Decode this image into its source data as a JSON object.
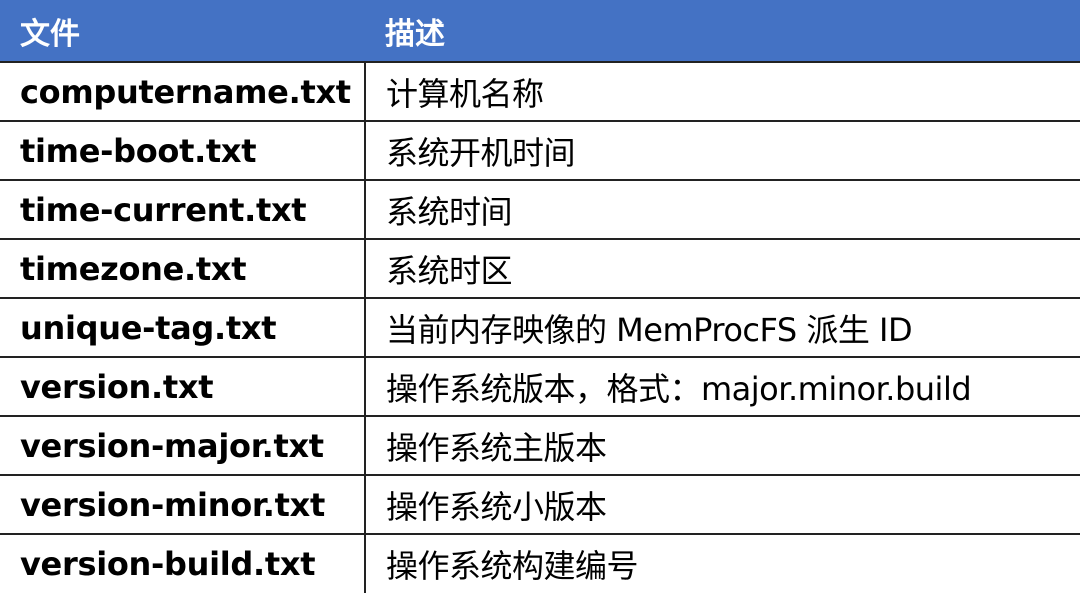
{
  "table": {
    "header": {
      "file": "文件",
      "description": "描述"
    },
    "colors": {
      "header_background": "#4472c4",
      "header_text": "#ffffff",
      "border": "#222222",
      "cell_text": "#000000"
    },
    "rows": [
      {
        "file": "computername.txt",
        "description": "计算机名称"
      },
      {
        "file": "time-boot.txt",
        "description": "系统开机时间"
      },
      {
        "file": "time-current.txt",
        "description": "系统时间"
      },
      {
        "file": "timezone.txt",
        "description": "系统时区"
      },
      {
        "file": "unique-tag.txt",
        "description": "当前内存映像的 MemProcFS 派生 ID"
      },
      {
        "file": "version.txt",
        "description": "操作系统版本，格式：major.minor.build"
      },
      {
        "file": "version-major.txt",
        "description": "操作系统主版本"
      },
      {
        "file": "version-minor.txt",
        "description": "操作系统小版本"
      },
      {
        "file": "version-build.txt",
        "description": "操作系统构建编号"
      }
    ]
  }
}
